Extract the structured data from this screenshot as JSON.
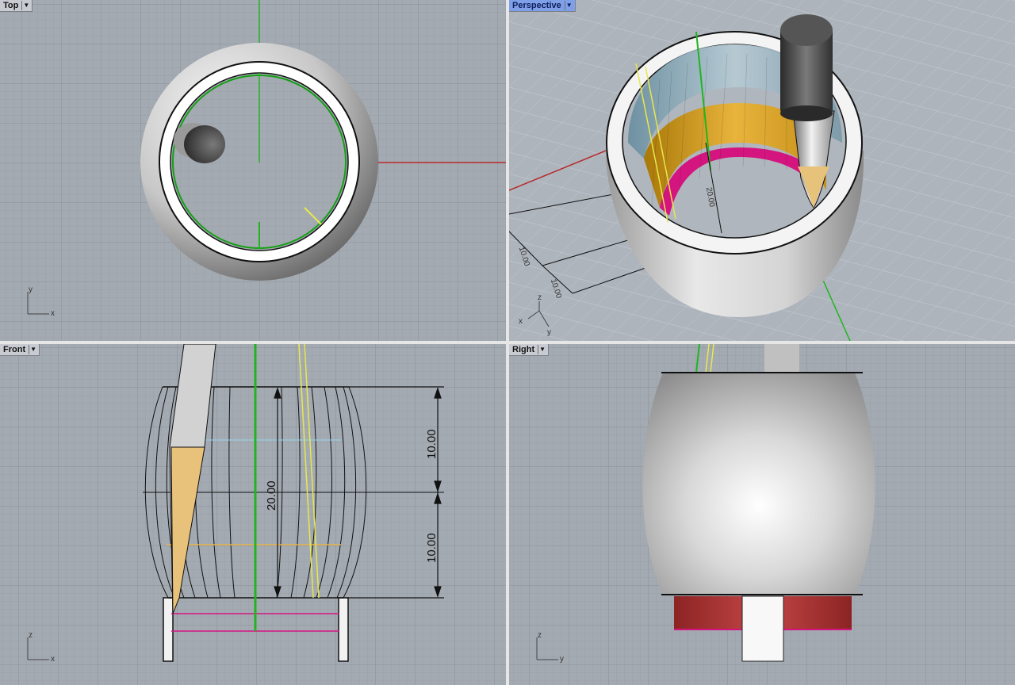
{
  "viewports": {
    "top": {
      "label": "Top",
      "axis_y": "y",
      "axis_x": "x"
    },
    "perspective": {
      "label": "Perspective",
      "axis_z": "z",
      "axis_x": "x",
      "axis_y": "y",
      "dim_a": "20.00",
      "dim_b": "10.00",
      "dim_c": "10.00"
    },
    "front": {
      "label": "Front",
      "axis_z": "z",
      "axis_x": "x",
      "dim_total": "20.00",
      "dim_upper": "10.00",
      "dim_lower": "10.00"
    },
    "right": {
      "label": "Right",
      "axis_z": "z",
      "axis_y": "y"
    }
  },
  "icons": {
    "viewport_menu": "dropdown-arrow-icon"
  },
  "colors": {
    "grid_bg": "#a4aab2",
    "active_tab": "#7fa0e8",
    "x_axis": "#b52a2a",
    "y_axis": "#1fb51f",
    "magenta": "#d4147f",
    "gold": "#d49a1a"
  }
}
